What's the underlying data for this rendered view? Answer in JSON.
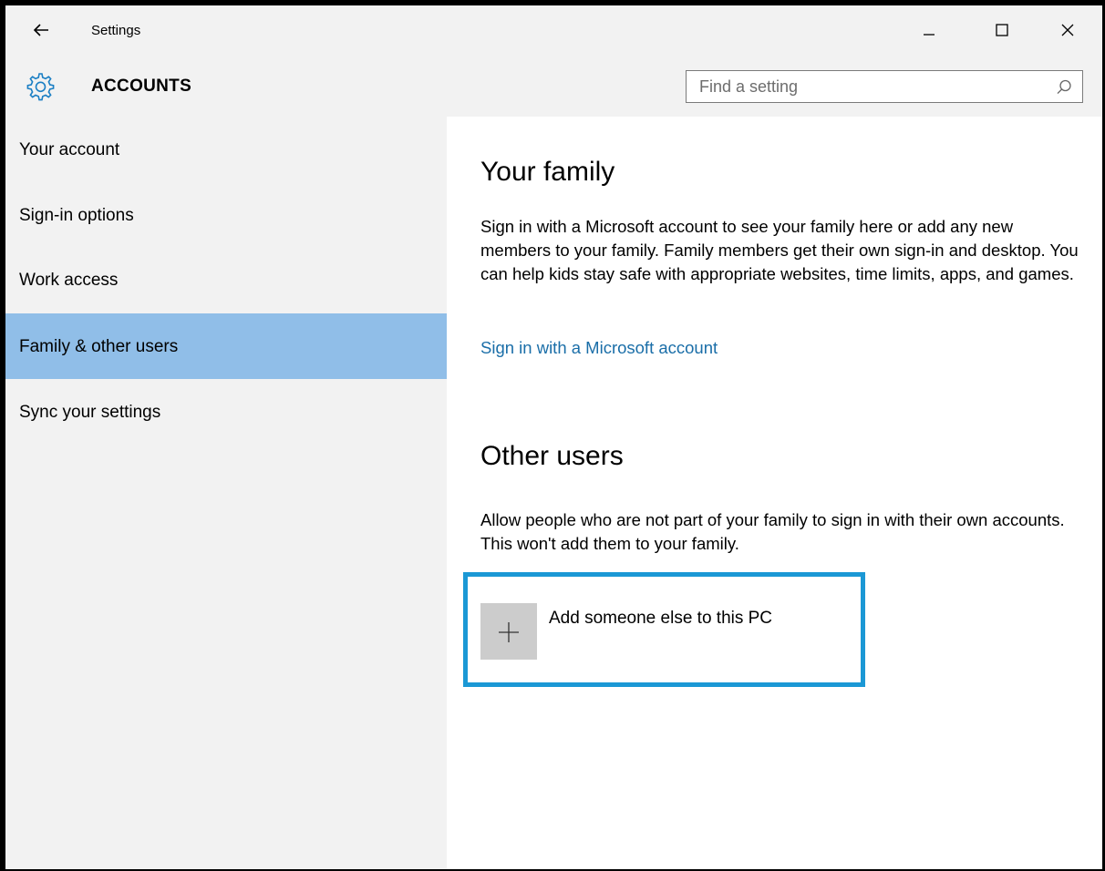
{
  "window": {
    "title": "Settings",
    "section": "ACCOUNTS"
  },
  "search": {
    "placeholder": "Find a setting",
    "value": ""
  },
  "sidebar": {
    "items": [
      {
        "label": "Your account"
      },
      {
        "label": "Sign-in options"
      },
      {
        "label": "Work access"
      },
      {
        "label": "Family & other users",
        "active": true
      },
      {
        "label": "Sync your settings"
      }
    ]
  },
  "family": {
    "heading": "Your family",
    "description": "Sign in with a Microsoft account to see your family here or add any new members to your family. Family members get their own sign-in and desktop. You can help kids stay safe with appropriate websites, time limits, apps, and games.",
    "link": "Sign in with a Microsoft account"
  },
  "other_users": {
    "heading": "Other users",
    "description": "Allow people who are not part of your family to sign in with their own accounts. This won't add them to your family.",
    "add_label": "Add someone else to this PC"
  },
  "colors": {
    "accent": "#1b98d5",
    "nav_active": "#90bee8",
    "link": "#1a6ea8",
    "tile": "#cccccc"
  },
  "icons": [
    "back-arrow-icon",
    "minimize-icon",
    "maximize-icon",
    "close-icon",
    "gear-icon",
    "search-icon",
    "plus-icon"
  ]
}
